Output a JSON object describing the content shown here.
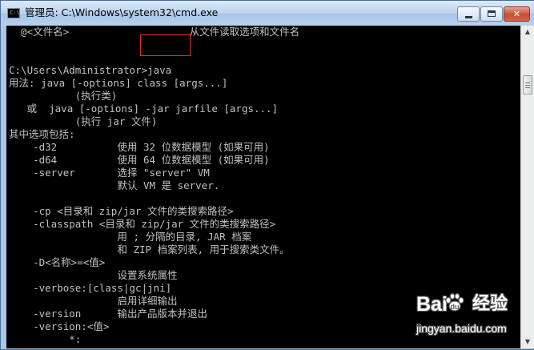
{
  "window": {
    "title": "管理员: C:\\Windows\\system32\\cmd.exe",
    "app_icon": "cmd-icon",
    "icon_text": "C:\\",
    "controls": {
      "minimize_icon": "minimize-icon",
      "maximize_icon": "maximize-icon",
      "close_icon": "close-icon",
      "close_glyph": "✕"
    }
  },
  "console": {
    "colors": {
      "background": "#000000",
      "text": "#c0c0c0",
      "highlight_box": "#e0302a"
    },
    "lines": [
      "  @<文件名>                    从文件读取选项和文件名",
      "",
      "",
      "C:\\Users\\Administrator>java",
      "用法: java [-options] class [args...]",
      "           (执行类)",
      "   或  java [-options] -jar jarfile [args...]",
      "           (执行 jar 文件)",
      "其中选项包括:",
      "    -d32          使用 32 位数据模型 (如果可用)",
      "    -d64          使用 64 位数据模型 (如果可用)",
      "    -server       选择 \"server\" VM",
      "                  默认 VM 是 server.",
      "",
      "    -cp <目录和 zip/jar 文件的类搜索路径>",
      "    -classpath <目录和 zip/jar 文件的类搜索路径>",
      "                  用 ; 分隔的目录, JAR 档案",
      "                  和 ZIP 档案列表, 用于搜索类文件。",
      "    -D<名称>=<值>",
      "                  设置系统属性",
      "    -verbose:[class|gc|jni]",
      "                  启用详细输出",
      "    -version      输出产品版本并退出",
      "    -version:<值>",
      "          *:"
    ]
  },
  "scrollbar": {
    "up_icon": "scroll-up-arrow-icon",
    "down_icon": "scroll-down-arrow-icon",
    "up_glyph": "▲",
    "down_glyph": "▼"
  },
  "watermark": {
    "brand": "Bai  经验",
    "brand_latin": "Bai",
    "brand_cn": "经验",
    "url": "jingyan.baidu.com",
    "paw_icon": "baidu-paw-icon"
  }
}
